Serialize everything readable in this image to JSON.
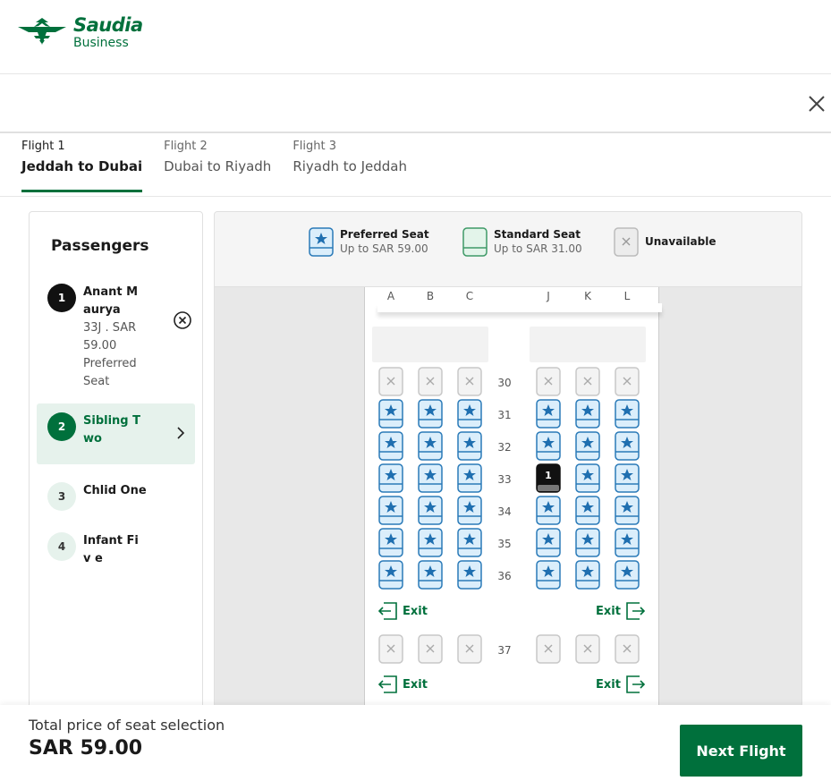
{
  "brand": {
    "name": "Saudia",
    "sub": "Business",
    "color": "#00703c"
  },
  "tabs": [
    {
      "num": "Flight 1",
      "route": "Jeddah to Dubai",
      "active": true
    },
    {
      "num": "Flight 2",
      "route": "Dubai to Riyadh",
      "active": false
    },
    {
      "num": "Flight 3",
      "route": "Riyadh to Jeddah",
      "active": false
    }
  ],
  "passengers": {
    "title": "Passengers",
    "list": [
      {
        "num": "1",
        "name": "Anant M aurya",
        "detail": "33J . SAR 59.00 Preferred Seat",
        "state": "assigned"
      },
      {
        "num": "2",
        "name": "Sibling T wo",
        "detail": "",
        "state": "selected"
      },
      {
        "num": "3",
        "name": "Chlid One",
        "detail": "",
        "state": "default"
      },
      {
        "num": "4",
        "name": "Infant Fiv e",
        "detail": "",
        "state": "default"
      }
    ]
  },
  "legend": [
    {
      "type": "preferred",
      "name": "Preferred Seat",
      "price": "Up to SAR 59.00"
    },
    {
      "type": "standard",
      "name": "Standard Seat",
      "price": "Up to SAR 31.00"
    },
    {
      "type": "unavailable",
      "name": "Unavailable",
      "price": ""
    }
  ],
  "seatmap": {
    "columns": [
      "A",
      "B",
      "C",
      "J",
      "K",
      "L"
    ],
    "rows": [
      {
        "num": "30",
        "seats": [
          "x",
          "x",
          "x",
          "x",
          "x",
          "x"
        ]
      },
      {
        "num": "31",
        "seats": [
          "p",
          "p",
          "p",
          "p",
          "p",
          "p"
        ]
      },
      {
        "num": "32",
        "seats": [
          "p",
          "p",
          "p",
          "p",
          "p",
          "p"
        ]
      },
      {
        "num": "33",
        "seats": [
          "p",
          "p",
          "p",
          "s1",
          "p",
          "p"
        ]
      },
      {
        "num": "34",
        "seats": [
          "p",
          "p",
          "p",
          "p",
          "p",
          "p"
        ]
      },
      {
        "num": "35",
        "seats": [
          "p",
          "p",
          "p",
          "p",
          "p",
          "p"
        ]
      },
      {
        "num": "36",
        "seats": [
          "p",
          "p",
          "p",
          "p",
          "p",
          "p"
        ]
      },
      {
        "num": "37",
        "seats": [
          "x",
          "x",
          "x",
          "x",
          "x",
          "x"
        ]
      }
    ],
    "exit_label": "Exit",
    "selected_seat_label": "1"
  },
  "footer": {
    "total_label": "Total price of seat selection",
    "total_price": "SAR 59.00",
    "next_label": "Next Flight"
  }
}
